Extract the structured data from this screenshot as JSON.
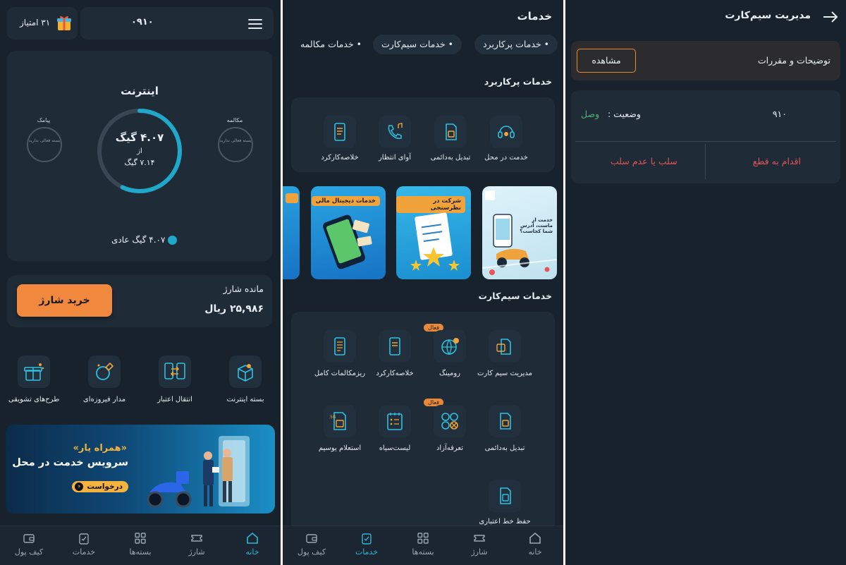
{
  "home": {
    "points_label": "۳۱ امتیاز",
    "phone_number": "۰۹۱۰",
    "internet": {
      "title": "اینترنت",
      "remaining": "۴.۰۷ گیگ",
      "of_label": "از",
      "total": "۷.۱۴ گیگ",
      "usage_fraction": 0.57
    },
    "calls": {
      "title": "مکالمه",
      "status": "بسته فعالی ندارید"
    },
    "sms": {
      "title": "پیامک",
      "status": "بسته فعالی ندارید"
    },
    "legend_text": "۴.۰۷ گیگ عادی",
    "balance_label": "مانده شارژ",
    "balance_value": "۲۵,۹۸۶ ریال",
    "buy_button": "خرید شارژ",
    "services": [
      {
        "label": "بسته اینترنت",
        "icon": "box-icon"
      },
      {
        "label": "انتقال اعتبار",
        "icon": "transfer-icon"
      },
      {
        "label": "مدار فیروزه‌ای",
        "icon": "ring-icon"
      },
      {
        "label": "طرح‌های تشویقی",
        "icon": "gift-icon"
      }
    ],
    "banner": {
      "quote": "«همراه یار»",
      "title": "سرویس خدمت در محل",
      "cta": "درخواست"
    }
  },
  "nav": {
    "home": "خانه",
    "charge": "شارژ",
    "packages": "بسته‌ها",
    "services": "خدمات",
    "wallet": "کیف پول"
  },
  "services_page": {
    "title": "خدمات",
    "chips": [
      "خدمات پرکاربرد",
      "خدمات سیم‌کارت",
      "خدمات مکالمه"
    ],
    "popular_title": "خدمات پرکاربرد",
    "popular": [
      {
        "label": "خدمت در محل",
        "icon": "headset-icon"
      },
      {
        "label": "تبدیل به‌دائمی",
        "icon": "sim-icon"
      },
      {
        "label": "آوای انتظار",
        "icon": "phone-music-icon"
      },
      {
        "label": "خلاصه‌کارکرد",
        "icon": "phone-list-icon"
      }
    ],
    "promos": [
      {
        "tag": "",
        "heading": "خدمت از ماست، آدرس شما کجاست؟"
      },
      {
        "tag": "شرکت در نظرسنجی"
      },
      {
        "tag": "خدمات دیجیتال مالی"
      }
    ],
    "sim_title": "خدمات سیم‌کارت",
    "active_badge": "فعال",
    "sim_services": [
      {
        "label": "مدیریت سیم کارت",
        "icon": "sim-manage-icon",
        "badge": false
      },
      {
        "label": "رومینگ",
        "icon": "globe-icon",
        "badge": true
      },
      {
        "label": "خلاصه‌کارکرد",
        "icon": "phone-list-icon",
        "badge": false
      },
      {
        "label": "ریزمکالمات کامل",
        "icon": "call-detail-icon",
        "badge": false
      },
      {
        "label": "تبدیل به‌دائمی",
        "icon": "sim-icon",
        "badge": false
      },
      {
        "label": "تعرفه‌آزاد",
        "icon": "tariff-icon",
        "badge": true
      },
      {
        "label": "لیست‌سیاه",
        "icon": "blacklist-icon",
        "badge": false
      },
      {
        "label": "استعلام یوسیم",
        "icon": "usim-icon",
        "badge": false
      },
      {
        "label": "حفظ خط اعتباری",
        "icon": "keep-line-icon",
        "badge": false
      }
    ]
  },
  "sim_manage": {
    "title": "مدیریت سیم‌کارت",
    "terms_label": "توضیحات و مقررات",
    "view_button": "مشاهده",
    "number": "۹۱۰",
    "status_label": "وضعیت :",
    "status_value": "وصل",
    "action_cut": "اقدام به قطع",
    "action_revoke": "سلب یا عدم سلب"
  }
}
